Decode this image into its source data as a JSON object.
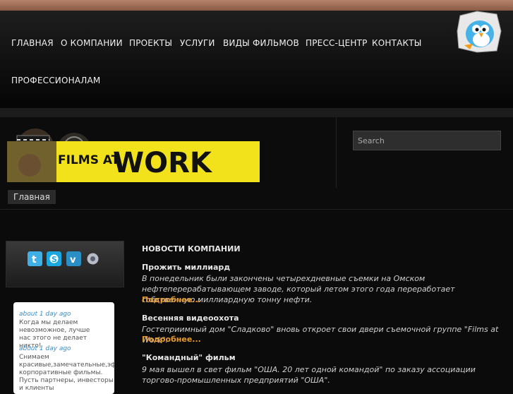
{
  "nav": {
    "items": [
      "ГЛАВНАЯ",
      "О КОМПАНИИ",
      "ПРОЕКТЫ",
      "УСЛУГИ",
      "ВИДЫ ФИЛЬМОВ",
      "ПРЕСС-ЦЕНТР",
      "КОНТАКТЫ",
      "ПРОФЕССИОНАЛАМ"
    ]
  },
  "logo": {
    "text_top": "FILMS AT",
    "text_bottom": "WORK",
    "accent": "#f2e21c"
  },
  "search": {
    "placeholder": "Search"
  },
  "breadcrumb": {
    "home": "Главная"
  },
  "social": {
    "icons": [
      "twitter-icon",
      "skype-icon",
      "vimeo-icon",
      "settings-icon"
    ]
  },
  "tweets": [
    {
      "time": "about 1 day ago",
      "text": "Когда мы делаем невозможное, лучше нас этого не делает никто!"
    },
    {
      "time": "about 1 day ago",
      "text": "Снимаем красивые,замечательные,эфф корпоративные фильмы. Пусть партнеры, инвесторы и клиенты"
    }
  ],
  "news": {
    "section_title": "НОВОСТИ КОМПАНИИ",
    "items": [
      {
        "title": "Прожить миллиард",
        "body": "В понедельник были закончены четырехдневные съемки на Омском нефтеперерабатывающем заводе, который летом этого года переработает собственную миллиардную тонну нефти.",
        "more": "Подробнее..."
      },
      {
        "title": "Весенняя видеоохота",
        "body": "Гостеприимный дом \"Сладково\" вновь откроет свои двери съемочной группе \"Films at Work\".",
        "more": "Подробнее..."
      },
      {
        "title": "\"Командный\" фильм",
        "body": "9 мая вышел в свет фильм \"ОША. 20 лет одной командой\" по заказу ассоциации торгово-промышленных предприятий \"ОША\"."
      }
    ]
  },
  "colors": {
    "link": "#e89a2c",
    "tweet_time": "#3a8fc9",
    "topbar": "#a97560"
  }
}
